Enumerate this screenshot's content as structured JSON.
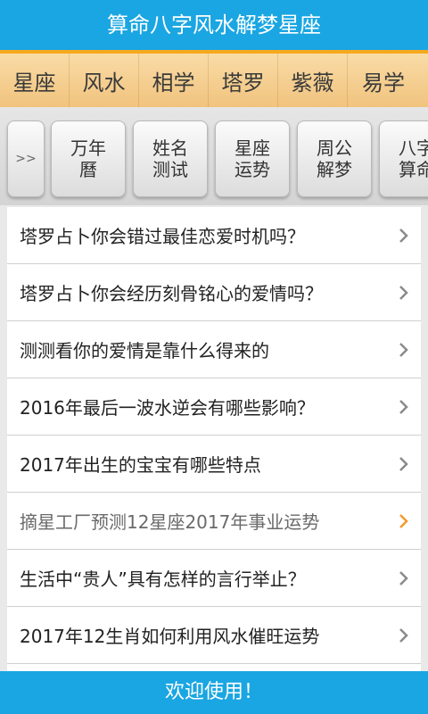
{
  "header": {
    "title": "算命八字风水解梦星座"
  },
  "categories": [
    "星座",
    "风水",
    "相学",
    "塔罗",
    "紫薇",
    "易学"
  ],
  "tools": {
    "more_label": ">>",
    "items": [
      "万年\n曆",
      "姓名\n测试",
      "星座\n运势",
      "周公\n解梦",
      "八字\n算命"
    ]
  },
  "articles": [
    "塔罗占卜你会错过最佳恋爱时机吗？",
    "塔罗占卜你会经历刻骨铭心的爱情吗？",
    "测测看你的爱情是靠什么得来的",
    "2016年最后一波水逆会有哪些影响？",
    "2017年出生的宝宝有哪些特点",
    "摘星工厂预测12星座2017年事业运势",
    "生活中“贵人”具有怎样的言行举止？",
    "2017年12生肖如何利用风水催旺运势"
  ],
  "footer": {
    "text": "欢迎使用！"
  },
  "colors": {
    "primary": "#1aa6e2",
    "accent": "#f6a91c",
    "chevron": "#8a8a8a",
    "chevron_active": "#f39a2b"
  }
}
